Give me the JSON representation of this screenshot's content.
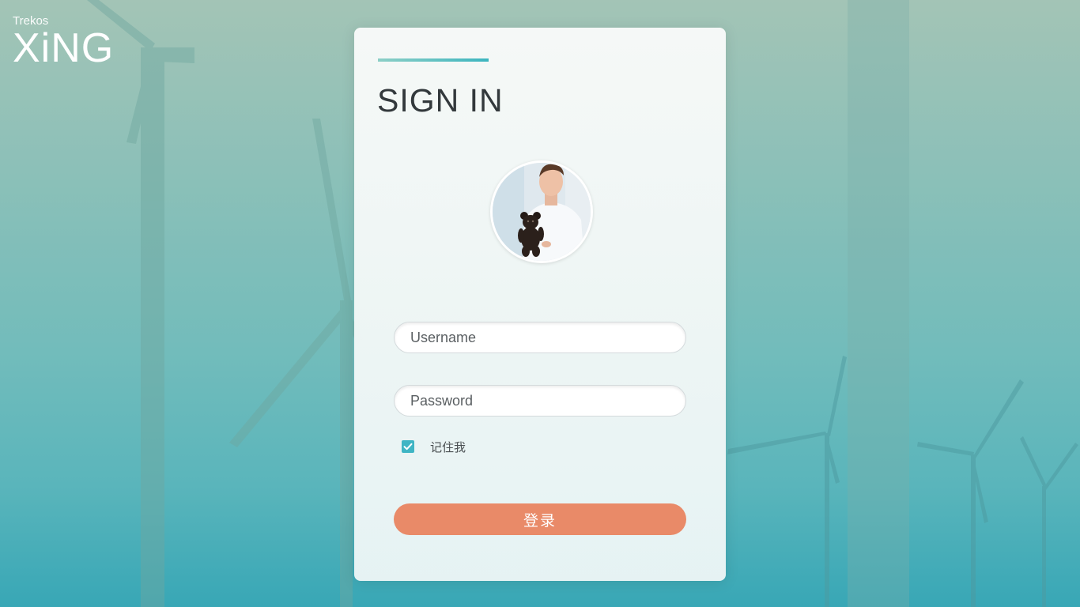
{
  "brand": {
    "small": "Trekos",
    "name": "XiNG"
  },
  "login": {
    "title": "SIGN IN",
    "avatar_icon": "user-avatar-photo",
    "username_placeholder": "Username",
    "password_placeholder": "Password",
    "remember_label": "记住我",
    "remember_checked": true,
    "submit_label": "登录"
  },
  "colors": {
    "accent": "#3fb5c4",
    "button": "#e98a68",
    "title": "#33393c"
  }
}
